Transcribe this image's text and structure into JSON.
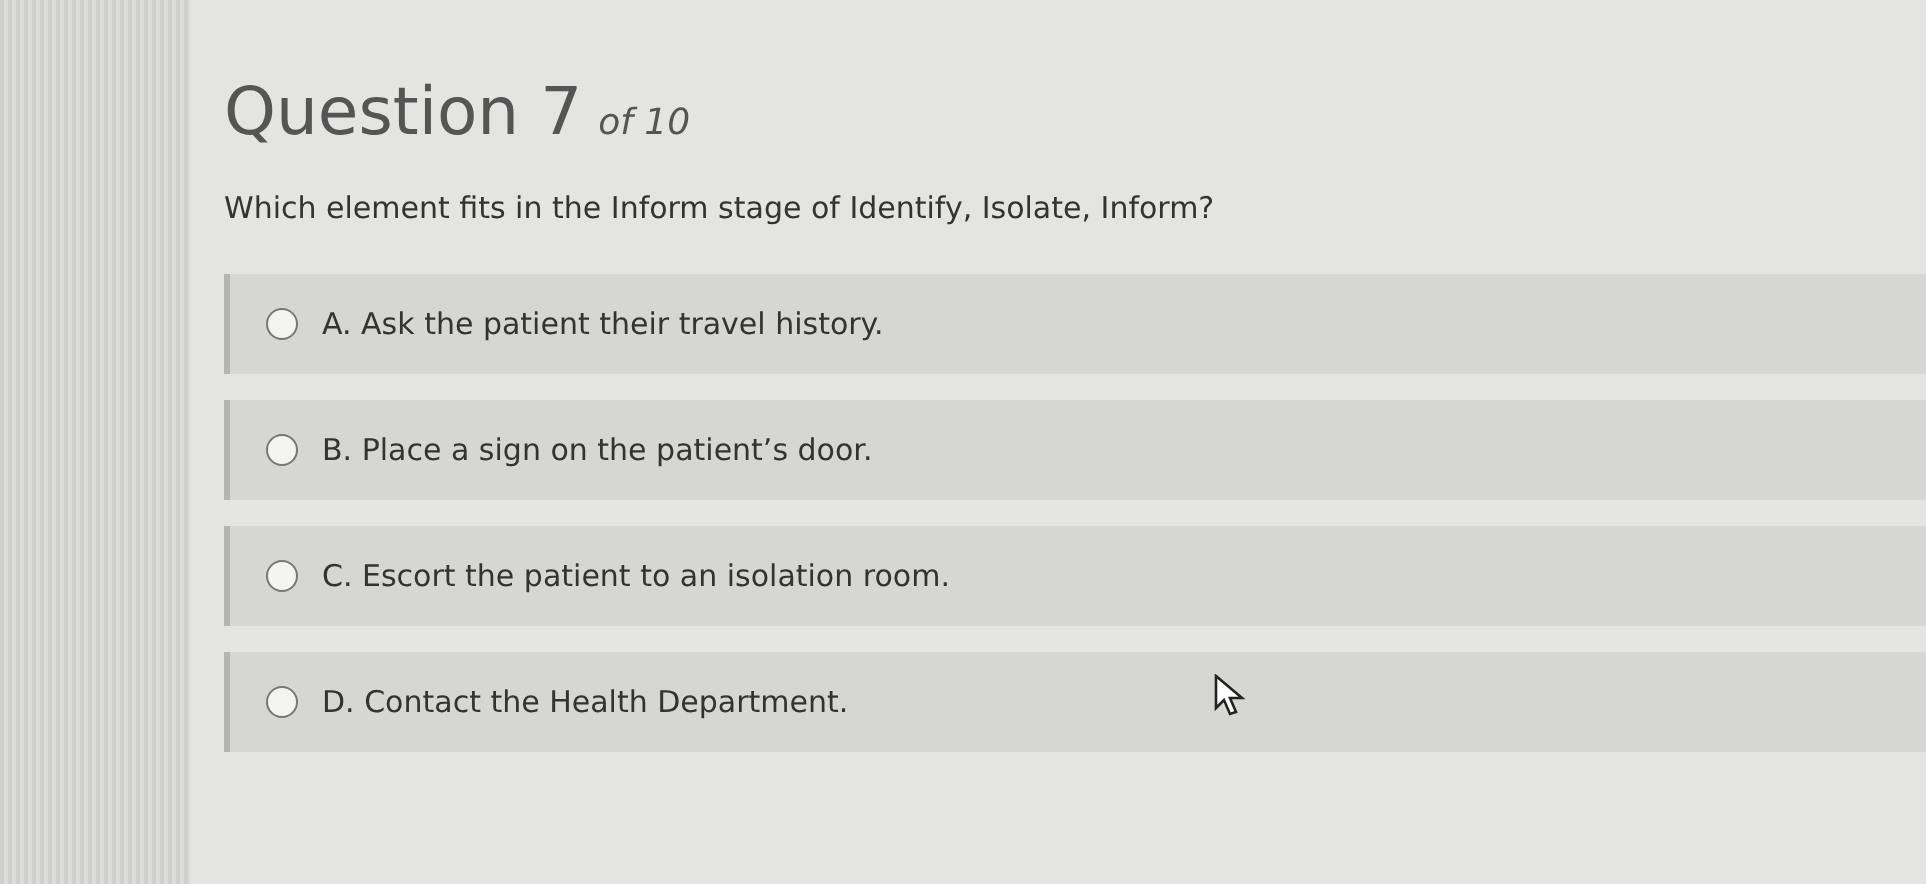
{
  "heading": {
    "title": "Question 7",
    "count": "of 10"
  },
  "prompt": "Which element fits in the Inform stage of Identify, Isolate, Inform?",
  "options": [
    {
      "label": "A. Ask the patient their travel history.",
      "selected": false
    },
    {
      "label": "B. Place a sign on the patient’s door.",
      "selected": false
    },
    {
      "label": "C. Escort the patient to an isolation room.",
      "selected": false
    },
    {
      "label": "D. Contact the Health Department.",
      "selected": false
    }
  ]
}
